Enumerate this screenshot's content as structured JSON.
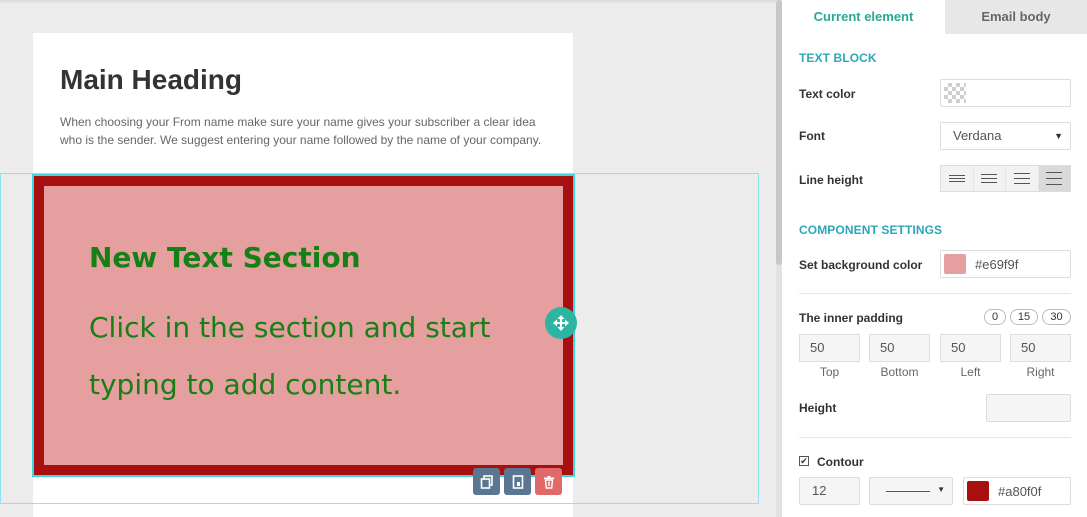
{
  "canvas": {
    "heading": "Main Heading",
    "intro": "When choosing your From name make sure your name gives your subscriber a clear idea who is the sender. We suggest entering your name followed by the name of your company.",
    "block": {
      "title": "New Text Section",
      "body": "Click in the section and start typing to add content."
    },
    "actions": {
      "move": "move-icon",
      "copy": "copy-icon",
      "save": "save-block-icon",
      "delete": "trash-icon"
    }
  },
  "panel": {
    "tabs": [
      "Current element",
      "Email body"
    ],
    "active_tab": "Current element",
    "text_block": {
      "title": "TEXT BLOCK",
      "text_color_label": "Text color",
      "font_label": "Font",
      "font_value": "Verdana",
      "line_height_label": "Line height",
      "line_height_active": 4
    },
    "component": {
      "title": "COMPONENT SETTINGS",
      "bg_label": "Set background color",
      "bg_color": "#e69f9f"
    },
    "padding": {
      "label": "The inner padding",
      "presets": [
        "0",
        "15",
        "30"
      ],
      "values": [
        {
          "label": "Top",
          "value": "50"
        },
        {
          "label": "Bottom",
          "value": "50"
        },
        {
          "label": "Left",
          "value": "50"
        },
        {
          "label": "Right",
          "value": "50"
        }
      ]
    },
    "height": {
      "label": "Height",
      "value": ""
    },
    "contour": {
      "label": "Contour",
      "checked": true,
      "width": "12",
      "color": "#a80f0f"
    }
  },
  "colors": {
    "accent": "#2aa796",
    "section_title": "#2aa7b8",
    "block_bg": "#e69f9f",
    "block_border": "#a80f0f",
    "block_text": "#168016",
    "delete": "#e06969",
    "action": "#5a7690"
  }
}
